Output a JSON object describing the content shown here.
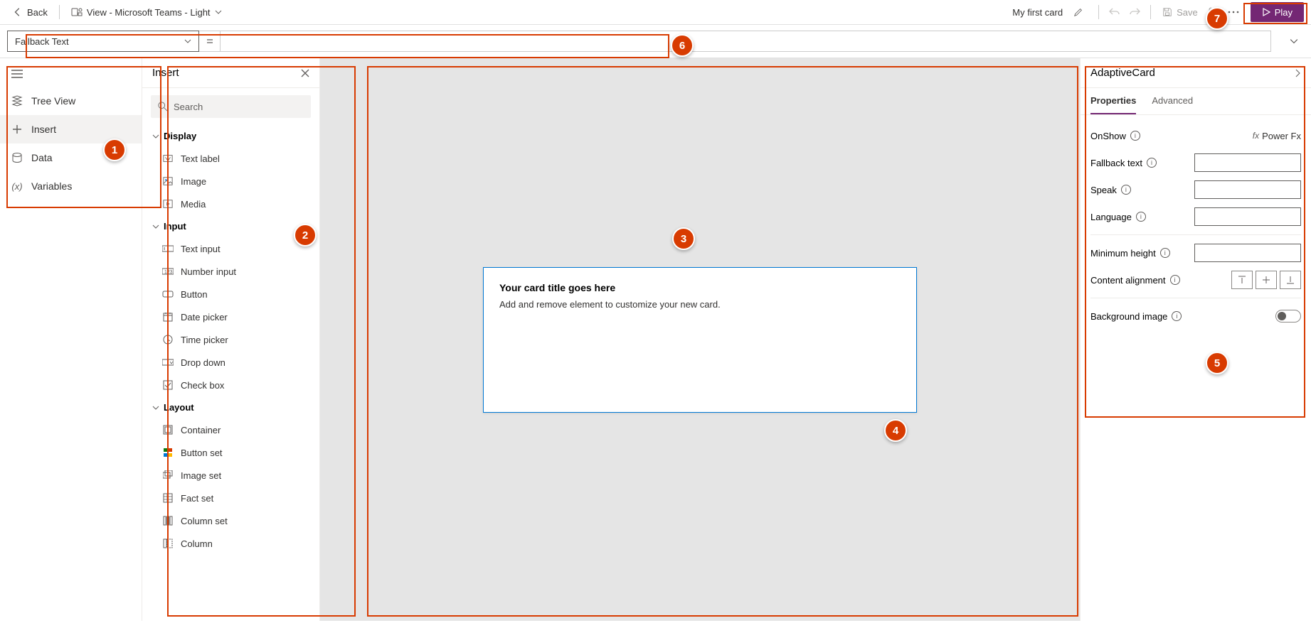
{
  "toolbar": {
    "back": "Back",
    "view_prefix": "View - Microsoft Teams - Light",
    "title": "My first card",
    "save": "Save",
    "play": "Play"
  },
  "formulabar": {
    "property": "Fallback Text",
    "value": ""
  },
  "leftrail": {
    "items": [
      {
        "label": "Tree View"
      },
      {
        "label": "Insert"
      },
      {
        "label": "Data"
      },
      {
        "label": "Variables"
      }
    ]
  },
  "insert": {
    "title": "Insert",
    "search_placeholder": "Search",
    "groups": [
      {
        "label": "Display",
        "items": [
          "Text label",
          "Image",
          "Media"
        ]
      },
      {
        "label": "Input",
        "items": [
          "Text input",
          "Number input",
          "Button",
          "Date picker",
          "Time picker",
          "Drop down",
          "Check box"
        ]
      },
      {
        "label": "Layout",
        "items": [
          "Container",
          "Button set",
          "Image set",
          "Fact set",
          "Column set",
          "Column"
        ]
      }
    ]
  },
  "card": {
    "title": "Your card title goes here",
    "body": "Add and remove element to customize your new card."
  },
  "props": {
    "header": "AdaptiveCard",
    "tabs": [
      "Properties",
      "Advanced"
    ],
    "onshow": "OnShow",
    "powerfx": "Power Fx",
    "rows": {
      "fallback": "Fallback text",
      "speak": "Speak",
      "language": "Language",
      "minheight": "Minimum height",
      "contentalign": "Content alignment",
      "bgimage": "Background image"
    }
  },
  "callouts": [
    "1",
    "2",
    "3",
    "4",
    "5",
    "6",
    "7"
  ]
}
